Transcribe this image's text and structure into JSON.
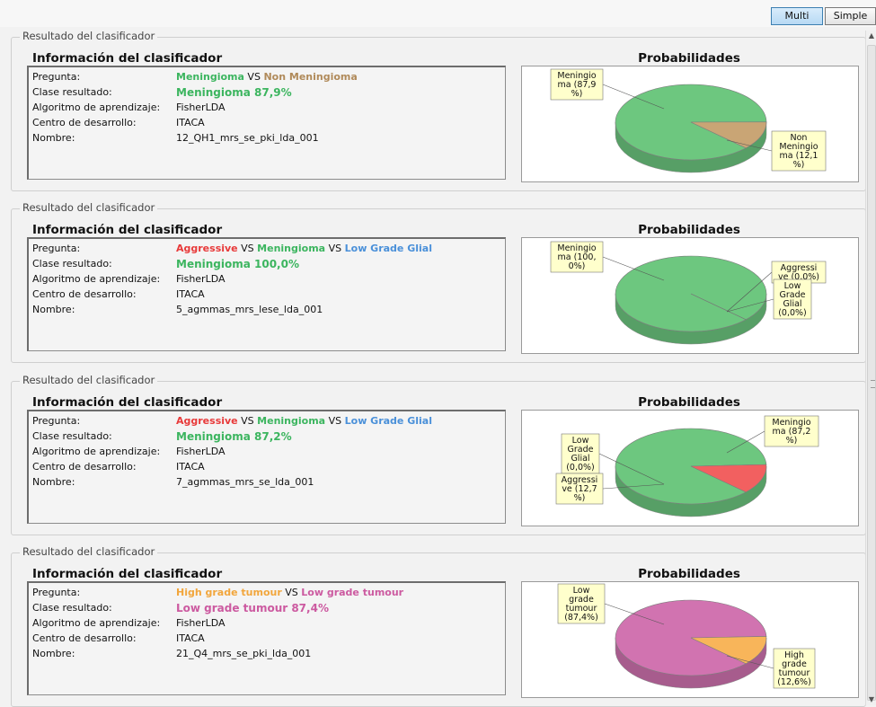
{
  "toolbar": {
    "multi_label": "Multi",
    "simple_label": "Simple"
  },
  "panels": [
    {
      "legend": "Resultado del clasificador",
      "info_title": "Información del clasificador",
      "labels": {
        "pregunta": "Pregunta:",
        "clase": "Clase resultado:",
        "algoritmo": "Algoritmo de aprendizaje:",
        "centro": "Centro de desarrollo:",
        "nombre": "Nombre:"
      },
      "question": [
        {
          "text": "Meningioma",
          "color": "#3cb55f",
          "bold": true
        },
        {
          "text": " VS ",
          "color": "#111111",
          "bold": false
        },
        {
          "text": "Non Meningioma",
          "color": "#b08a5a",
          "bold": true
        }
      ],
      "result": {
        "text": "Meningioma 87,9%",
        "color": "#3cb55f"
      },
      "algorithm": "FisherLDA",
      "center": "ITACA",
      "name": "12_QH1_mrs_se_pki_lda_001",
      "prob_title": "Probabilidades",
      "chart_data": {
        "type": "pie",
        "slices": [
          {
            "name": "Meningioma",
            "value": 87.9,
            "color": "#6dc77f",
            "label_lines": [
              "Meningio",
              "ma (87,9",
              "%)"
            ]
          },
          {
            "name": "Non Meningioma",
            "value": 12.1,
            "color": "#c9a575",
            "label_lines": [
              "Non",
              "Meningio",
              "ma (12,1",
              "%)"
            ]
          }
        ]
      }
    },
    {
      "legend": "Resultado del clasificador",
      "info_title": "Información del clasificador",
      "labels": {
        "pregunta": "Pregunta:",
        "clase": "Clase resultado:",
        "algoritmo": "Algoritmo de aprendizaje:",
        "centro": "Centro de desarrollo:",
        "nombre": "Nombre:"
      },
      "question": [
        {
          "text": "Aggressive",
          "color": "#e83a3a",
          "bold": true
        },
        {
          "text": " VS ",
          "color": "#111111",
          "bold": false
        },
        {
          "text": "Meningioma",
          "color": "#3cb55f",
          "bold": true
        },
        {
          "text": " VS ",
          "color": "#111111",
          "bold": false
        },
        {
          "text": "Low Grade Glial",
          "color": "#4a90d9",
          "bold": true
        }
      ],
      "result": {
        "text": "Meningioma 100,0%",
        "color": "#3cb55f"
      },
      "algorithm": "FisherLDA",
      "center": "ITACA",
      "name": "5_agmmas_mrs_lese_lda_001",
      "prob_title": "Probabilidades",
      "chart_data": {
        "type": "pie",
        "slices": [
          {
            "name": "Meningioma",
            "value": 100.0,
            "color": "#6dc77f",
            "label_lines": [
              "Meningio",
              "ma (100,",
              "0%)"
            ]
          },
          {
            "name": "Aggressive",
            "value": 0.0,
            "color": "#f26060",
            "label_lines": [
              "Aggressi",
              "ve (0,0%)"
            ]
          },
          {
            "name": "Low Grade Glial",
            "value": 0.0,
            "color": "#6aa9e6",
            "label_lines": [
              "Low",
              "Grade",
              "Glial",
              "(0,0%)"
            ]
          }
        ]
      }
    },
    {
      "legend": "Resultado del clasificador",
      "info_title": "Información del clasificador",
      "labels": {
        "pregunta": "Pregunta:",
        "clase": "Clase resultado:",
        "algoritmo": "Algoritmo de aprendizaje:",
        "centro": "Centro de desarrollo:",
        "nombre": "Nombre:"
      },
      "question": [
        {
          "text": "Aggressive",
          "color": "#e83a3a",
          "bold": true
        },
        {
          "text": " VS ",
          "color": "#111111",
          "bold": false
        },
        {
          "text": "Meningioma",
          "color": "#3cb55f",
          "bold": true
        },
        {
          "text": " VS ",
          "color": "#111111",
          "bold": false
        },
        {
          "text": "Low Grade Glial",
          "color": "#4a90d9",
          "bold": true
        }
      ],
      "result": {
        "text": "Meningioma 87,2%",
        "color": "#3cb55f"
      },
      "algorithm": "FisherLDA",
      "center": "ITACA",
      "name": "7_agmmas_mrs_se_lda_001",
      "prob_title": "Probabilidades",
      "chart_data": {
        "type": "pie",
        "slices": [
          {
            "name": "Meningioma",
            "value": 87.2,
            "color": "#6dc77f",
            "label_lines": [
              "Meningio",
              "ma (87,2",
              "%)"
            ]
          },
          {
            "name": "Low Grade Glial",
            "value": 0.0,
            "color": "#6aa9e6",
            "label_lines": [
              "Low",
              "Grade",
              "Glial",
              "(0,0%)"
            ]
          },
          {
            "name": "Aggressive",
            "value": 12.7,
            "color": "#f26060",
            "label_lines": [
              "Aggressi",
              "ve (12,7",
              "%)"
            ]
          }
        ]
      }
    },
    {
      "legend": "Resultado del clasificador",
      "info_title": "Información del clasificador",
      "labels": {
        "pregunta": "Pregunta:",
        "clase": "Clase resultado:",
        "algoritmo": "Algoritmo de aprendizaje:",
        "centro": "Centro de desarrollo:",
        "nombre": "Nombre:"
      },
      "question": [
        {
          "text": "High grade tumour",
          "color": "#f2a63c",
          "bold": true
        },
        {
          "text": " VS ",
          "color": "#111111",
          "bold": false
        },
        {
          "text": "Low grade tumour",
          "color": "#cc5aa0",
          "bold": true
        }
      ],
      "result": {
        "text": "Low grade tumour 87,4%",
        "color": "#cc5aa0"
      },
      "algorithm": "FisherLDA",
      "center": "ITACA",
      "name": "21_Q4_mrs_se_pki_lda_001",
      "prob_title": "Probabilidades",
      "chart_data": {
        "type": "pie",
        "slices": [
          {
            "name": "Low grade tumour",
            "value": 87.4,
            "color": "#d173b0",
            "label_lines": [
              "Low",
              "grade",
              "tumour",
              "(87,4%)"
            ]
          },
          {
            "name": "High grade tumour",
            "value": 12.6,
            "color": "#f8b55a",
            "label_lines": [
              "High",
              "grade",
              "tumour",
              "(12,6%)"
            ]
          }
        ]
      }
    }
  ]
}
